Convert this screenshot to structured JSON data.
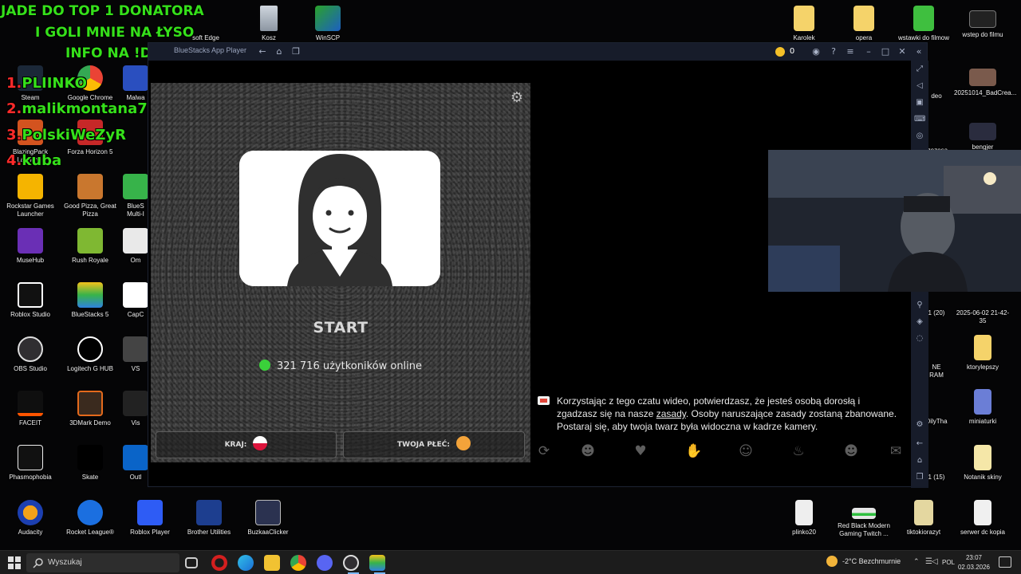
{
  "overlay": {
    "line1": "JADE DO TOP 1 DONATORA",
    "line2": "I GOLI MNIE NA ŁYSO",
    "line3": "INFO NA !DC",
    "top_donors": [
      {
        "rank": "1.",
        "name": "PLIINKO"
      },
      {
        "rank": "2.",
        "name": "malikmontana7"
      },
      {
        "rank": "3.",
        "name": "PolskiWeZyR"
      },
      {
        "rank": "4.",
        "name": "kuba"
      }
    ]
  },
  "desktop": {
    "left_icons": [
      {
        "label": "Steam"
      },
      {
        "label": "Google Chrome"
      },
      {
        "label": "Malwa"
      },
      {
        "label": "BlazingPack Launcher"
      },
      {
        "label": "Forza Horizon 5"
      },
      {
        "label": "Rockstar Games Launcher"
      },
      {
        "label": "Good Pizza, Great Pizza"
      },
      {
        "label": "BlueS Multi-I"
      },
      {
        "label": "MuseHub"
      },
      {
        "label": "Rush Royale"
      },
      {
        "label": "Om"
      },
      {
        "label": "Roblox Studio"
      },
      {
        "label": "BlueStacks 5"
      },
      {
        "label": "CapC"
      },
      {
        "label": "OBS Studio"
      },
      {
        "label": "Logitech G HUB"
      },
      {
        "label": "VS"
      },
      {
        "label": "FACEIT"
      },
      {
        "label": "3DMark Demo"
      },
      {
        "label": "Vis"
      },
      {
        "label": "Phasmophobia"
      },
      {
        "label": "Skate"
      },
      {
        "label": "Outl"
      },
      {
        "label": "Audacity"
      },
      {
        "label": "Rocket League®"
      },
      {
        "label": "Roblox Player"
      },
      {
        "label": "Brother Utilities"
      },
      {
        "label": "BuzkaaClicker"
      }
    ],
    "top_icons": [
      {
        "label": "Kosz"
      },
      {
        "label": "WinSCP"
      },
      {
        "label": "soft Edge"
      }
    ],
    "right_icons": [
      {
        "label": "Karolek"
      },
      {
        "label": "opera"
      },
      {
        "label": "wstawki do filmow"
      },
      {
        "label": "wstep do filmu"
      },
      {
        "label": "deo"
      },
      {
        "label": "20251014_BadCrea..."
      },
      {
        "label": "rzezesa"
      },
      {
        "label": "bengjer"
      },
      {
        "label": "1 (20)"
      },
      {
        "label": "2025-06-02 21-42-35"
      },
      {
        "label": "NE RAM"
      },
      {
        "label": "ktorylepszy"
      },
      {
        "label": "OilyTha..."
      },
      {
        "label": "miniaturki"
      },
      {
        "label": "1 (15)"
      },
      {
        "label": "Notanik skiny"
      },
      {
        "label": "plinko20"
      },
      {
        "label": "Red Black Modern Gaming Twitch ..."
      },
      {
        "label": "tiktokiorazyt"
      },
      {
        "label": "serwer dc kopia"
      }
    ]
  },
  "bluestacks": {
    "title": "BlueStacks App Player",
    "coins": "0"
  },
  "app": {
    "start_label": "START",
    "online_count": "321 716 użytkoników online",
    "country_label": "KRAJ:",
    "gender_label": "TWOJA PŁEĆ:"
  },
  "chat": {
    "message_pre": "Korzystając z tego czatu wideo, potwierdzasz, że jesteś osobą dorosłą i zgadzasz się na nasze ",
    "rules_link": "zasady",
    "message_post": ". Osoby naruszające zasady zostaną zbanowane. Postaraj się, aby twoja twarz była widoczna w kadrze kamery."
  },
  "taskbar": {
    "search_placeholder": "Wyszukaj",
    "weather": "-2°C  Bezchmurnie",
    "language": "POL",
    "time": "23:07",
    "date": "02.03.2026"
  }
}
